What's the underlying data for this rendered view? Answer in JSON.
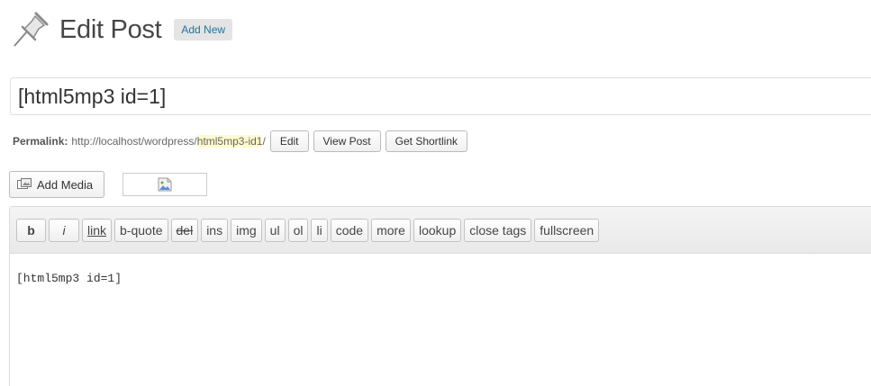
{
  "header": {
    "icon": "pushpin-icon",
    "title": "Edit Post",
    "add_new_label": "Add New"
  },
  "post": {
    "title_value": "[html5mp3 id=1]"
  },
  "permalink": {
    "label": "Permalink:",
    "base_url": "http://localhost/wordpress/",
    "slug": "html5mp3-id1",
    "suffix": "/",
    "buttons": [
      "Edit",
      "View Post",
      "Get Shortlink"
    ]
  },
  "media": {
    "add_media_label": "Add Media",
    "icon": "media-icon"
  },
  "quicktags": [
    "b",
    "i",
    "link",
    "b-quote",
    "del",
    "ins",
    "img",
    "ul",
    "ol",
    "li",
    "code",
    "more",
    "lookup",
    "close tags",
    "fullscreen"
  ],
  "editor": {
    "content": "[html5mp3 id=1]"
  },
  "colors": {
    "link": "#21759b",
    "slug_highlight": "#fffbcc"
  }
}
